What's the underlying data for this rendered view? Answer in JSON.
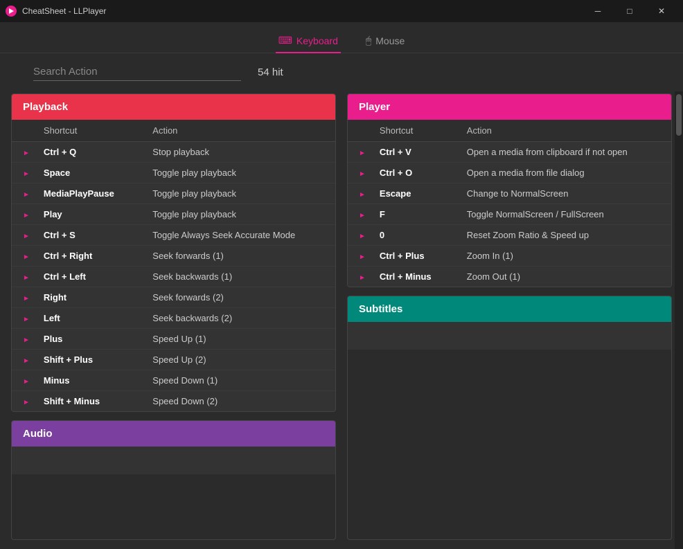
{
  "window": {
    "title": "CheatSheet - LLPlayer",
    "minimize_label": "─",
    "maximize_label": "□",
    "close_label": "✕"
  },
  "tabs": [
    {
      "id": "keyboard",
      "label": "Keyboard",
      "icon": "⌨",
      "active": true
    },
    {
      "id": "mouse",
      "label": "Mouse",
      "icon": "🖱",
      "active": false
    }
  ],
  "search": {
    "placeholder": "Search Action",
    "value": "",
    "hit_count": "54 hit"
  },
  "sections": {
    "playback": {
      "header": "Playback",
      "columns": [
        "Shortcut",
        "Action"
      ],
      "rows": [
        {
          "shortcut": "Ctrl + Q",
          "action": "Stop playback"
        },
        {
          "shortcut": "Space",
          "action": "Toggle play playback"
        },
        {
          "shortcut": "MediaPlayPause",
          "action": "Toggle play playback"
        },
        {
          "shortcut": "Play",
          "action": "Toggle play playback"
        },
        {
          "shortcut": "Ctrl + S",
          "action": "Toggle Always Seek Accurate Mode"
        },
        {
          "shortcut": "Ctrl + Right",
          "action": "Seek forwards (1)"
        },
        {
          "shortcut": "Ctrl + Left",
          "action": "Seek backwards (1)"
        },
        {
          "shortcut": "Right",
          "action": "Seek forwards (2)"
        },
        {
          "shortcut": "Left",
          "action": "Seek backwards (2)"
        },
        {
          "shortcut": "Plus",
          "action": "Speed Up (1)"
        },
        {
          "shortcut": "Shift + Plus",
          "action": "Speed Up (2)"
        },
        {
          "shortcut": "Minus",
          "action": "Speed Down (1)"
        },
        {
          "shortcut": "Shift + Minus",
          "action": "Speed Down (2)"
        }
      ]
    },
    "player": {
      "header": "Player",
      "columns": [
        "Shortcut",
        "Action"
      ],
      "rows": [
        {
          "shortcut": "Ctrl + V",
          "action": "Open a media from clipboard if not open"
        },
        {
          "shortcut": "Ctrl + O",
          "action": "Open a media from file dialog"
        },
        {
          "shortcut": "Escape",
          "action": "Change to NormalScreen"
        },
        {
          "shortcut": "F",
          "action": "Toggle NormalScreen / FullScreen"
        },
        {
          "shortcut": "0",
          "action": "Reset Zoom Ratio & Speed up"
        },
        {
          "shortcut": "Ctrl + Plus",
          "action": "Zoom In (1)"
        },
        {
          "shortcut": "Ctrl + Minus",
          "action": "Zoom Out (1)"
        }
      ]
    },
    "audio": {
      "header": "Audio"
    },
    "subtitles": {
      "header": "Subtitles"
    }
  }
}
